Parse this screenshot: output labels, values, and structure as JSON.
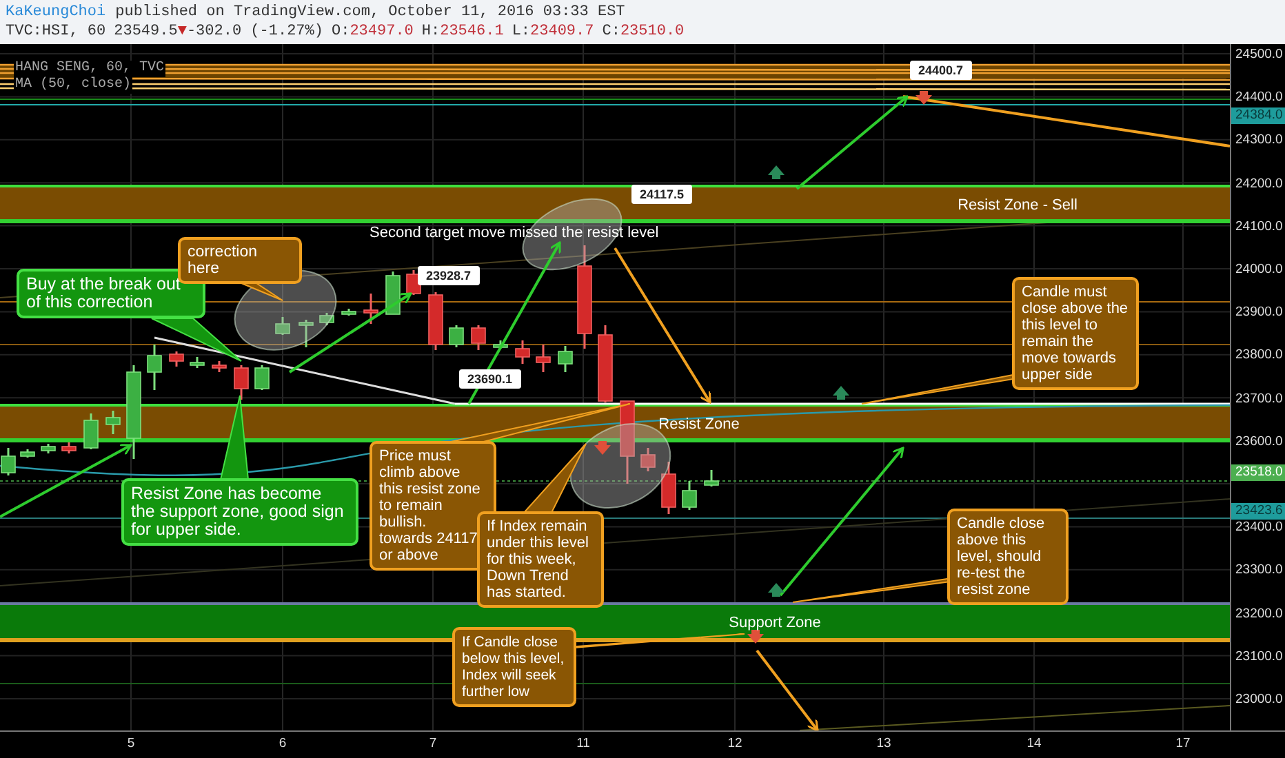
{
  "header": {
    "author": "KaKeungChoi",
    "published": "published on TradingView.com, October 11, 2016 03:33 EST",
    "symbol": "TVC:HSI, 60",
    "last": "23549.5",
    "change_icon": "▼",
    "change": "-302.0 (-1.27%)",
    "ohlc": [
      {
        "label": "O:",
        "value": "23497.0"
      },
      {
        "label": "H:",
        "value": "23546.1"
      },
      {
        "label": "L:",
        "value": "23409.7"
      },
      {
        "label": "C:",
        "value": "23510.0"
      }
    ]
  },
  "legend": [
    "HANG SENG, 60, TVC",
    "MA (50, close)"
  ],
  "zones": [
    {
      "label": "Resist Zone - Sell",
      "kind": "resist"
    },
    {
      "label": "Resist Zone",
      "kind": "resist"
    },
    {
      "label": "Support Zone",
      "kind": "support"
    }
  ],
  "price_labels": [
    "24400.7",
    "24117.5",
    "23928.7",
    "23690.1"
  ],
  "note": "Second target move missed the resist level",
  "callouts": [
    {
      "text": "Buy at the break out of this correction",
      "color": "#13960f"
    },
    {
      "text": "correction here",
      "color": "#8a5604"
    },
    {
      "text": "Resist Zone has become the support zone, good sign for upper side.",
      "color": "#13960f"
    },
    {
      "text": "Price must climb above this resist zone to remain bullish.\ntowards 24117\nor above",
      "color": "#8a5604"
    },
    {
      "text": "If Index remain under this level for this week, Down Trend has started.",
      "color": "#8a5604"
    },
    {
      "text": "Candle must close above the this level to remain the move towards upper side",
      "color": "#8a5604"
    },
    {
      "text": "Candle close above this level, should re-test the resist zone",
      "color": "#8a5604"
    },
    {
      "text": "If Candle close below this level, Index will seek further low",
      "color": "#8a5604"
    }
  ],
  "y_axis": {
    "ticks": [
      "24500.0",
      "24400.0",
      "24300.0",
      "24200.0",
      "24100.0",
      "24000.0",
      "23900.0",
      "23800.0",
      "23700.0",
      "23600.0",
      "23400.0",
      "23300.0",
      "23200.0",
      "23100.0",
      "23000.0"
    ],
    "badges": [
      {
        "text": "24384.0",
        "color": "#1e9c9c"
      },
      {
        "text": "23518.0",
        "color": "#4caf50"
      },
      {
        "text": "23423.6",
        "color": "#1e9c9c"
      }
    ]
  },
  "x_axis": [
    "5",
    "6",
    "7",
    "11",
    "12",
    "13",
    "14",
    "17"
  ]
}
